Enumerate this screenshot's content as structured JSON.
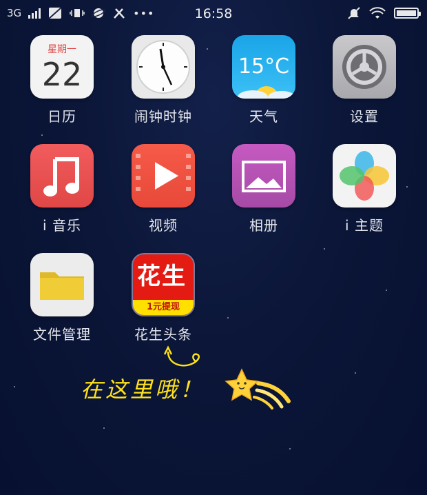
{
  "status_bar": {
    "network": "3G",
    "time": "16:58",
    "more": "•••"
  },
  "apps": [
    {
      "id": "calendar",
      "label": "日历",
      "weekday": "星期一",
      "day": "22"
    },
    {
      "id": "clock",
      "label": "闹钟时钟"
    },
    {
      "id": "weather",
      "label": "天气",
      "temperature": "15°C"
    },
    {
      "id": "settings",
      "label": "设置"
    },
    {
      "id": "music",
      "label": "i 音乐"
    },
    {
      "id": "video",
      "label": "视频"
    },
    {
      "id": "gallery",
      "label": "相册"
    },
    {
      "id": "theme",
      "label": "i 主题"
    },
    {
      "id": "files",
      "label": "文件管理"
    },
    {
      "id": "peanut-news",
      "label": "花生头条",
      "icon_text": "花生",
      "icon_banner": "1元提现"
    }
  ],
  "callout": {
    "text": "在这里哦！",
    "color": "#ffe21a"
  }
}
